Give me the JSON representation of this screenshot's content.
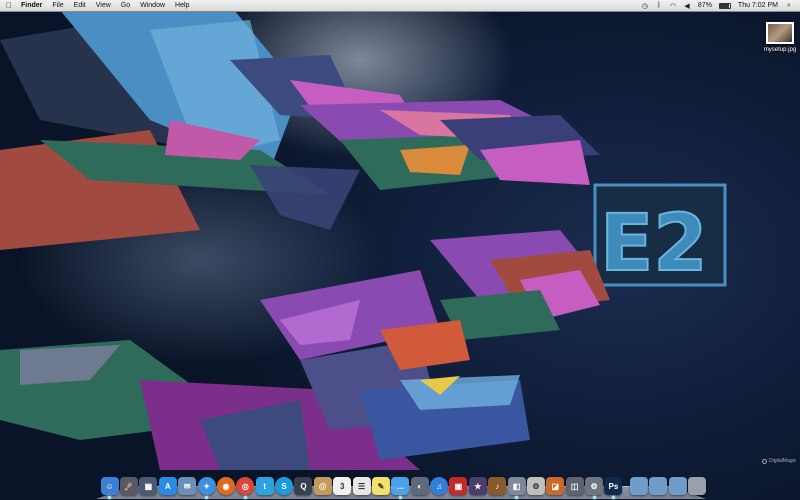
{
  "menubar": {
    "apple_icon": "apple-icon",
    "app_name": "Finder",
    "menus": [
      "File",
      "Edit",
      "View",
      "Go",
      "Window",
      "Help"
    ],
    "battery_percent": "87%",
    "battery_level": 0.87,
    "clock": "Thu 7:02 PM",
    "status_icons": [
      "time-machine-icon",
      "bluetooth-icon",
      "wifi-icon",
      "volume-icon",
      "spotlight-icon"
    ]
  },
  "desktop": {
    "file_name": "mysetup.jpg",
    "watermark": "DigitalMagic",
    "colors": {
      "sky": "#0c1a33",
      "accent_blue": "#4a8fc4",
      "accent_purple": "#8a4bb0",
      "accent_green": "#2f6b5a",
      "accent_red": "#a14a3f"
    }
  },
  "dock": {
    "apps": [
      {
        "name": "finder-icon",
        "color": "#3b7fd6",
        "glyph": "☺",
        "running": true
      },
      {
        "name": "launchpad-icon",
        "color": "#555b66",
        "glyph": "🚀",
        "running": false
      },
      {
        "name": "mission-control-icon",
        "color": "#4b5a72",
        "glyph": "▦",
        "running": false
      },
      {
        "name": "app-store-icon",
        "color": "#2a8ae6",
        "glyph": "A",
        "running": false
      },
      {
        "name": "mail-icon",
        "color": "#6c8fb8",
        "glyph": "✉",
        "running": false
      },
      {
        "name": "safari-icon",
        "color": "#3f8fe0",
        "glyph": "✦",
        "running": true
      },
      {
        "name": "firefox-icon",
        "color": "#e06b1f",
        "glyph": "◉",
        "running": false
      },
      {
        "name": "chrome-icon",
        "color": "#d9463b",
        "glyph": "◎",
        "running": true
      },
      {
        "name": "twitter-icon",
        "color": "#2aa3e0",
        "glyph": "t",
        "running": false
      },
      {
        "name": "skype-icon",
        "color": "#1c9be0",
        "glyph": "S",
        "running": false
      },
      {
        "name": "quicktime-icon",
        "color": "#39404d",
        "glyph": "Q",
        "running": false
      },
      {
        "name": "address-book-icon",
        "color": "#c49a5a",
        "glyph": "@",
        "running": false
      },
      {
        "name": "calendar-icon",
        "color": "#f0f0f0",
        "glyph": "3",
        "running": false
      },
      {
        "name": "reminders-icon",
        "color": "#e8e8e8",
        "glyph": "☰",
        "running": false
      },
      {
        "name": "notes-icon",
        "color": "#f3df6a",
        "glyph": "✎",
        "running": false
      },
      {
        "name": "messages-icon",
        "color": "#4aa3e8",
        "glyph": "…",
        "running": true
      },
      {
        "name": "facetime-icon",
        "color": "#5e6a7a",
        "glyph": "◐",
        "running": false
      },
      {
        "name": "itunes-icon",
        "color": "#2f7fd8",
        "glyph": "♫",
        "running": false
      },
      {
        "name": "photo-booth-icon",
        "color": "#c32a2a",
        "glyph": "▣",
        "running": false
      },
      {
        "name": "imovie-icon",
        "color": "#4a3d6b",
        "glyph": "★",
        "running": false
      },
      {
        "name": "garageband-icon",
        "color": "#8a5a2a",
        "glyph": "♪",
        "running": false
      },
      {
        "name": "preview-icon",
        "color": "#7d8898",
        "glyph": "◧",
        "running": true
      },
      {
        "name": "automator-icon",
        "color": "#bfbfbf",
        "glyph": "⚙",
        "running": false
      },
      {
        "name": "photo-app-icon",
        "color": "#c96a2a",
        "glyph": "◪",
        "running": false
      },
      {
        "name": "image-capture-icon",
        "color": "#5c6470",
        "glyph": "◫",
        "running": false
      },
      {
        "name": "system-preferences-icon",
        "color": "#6e7580",
        "glyph": "⚙",
        "running": true
      },
      {
        "name": "photoshop-icon",
        "color": "#0e2a4d",
        "glyph": "Ps",
        "running": true
      }
    ],
    "stacks": [
      {
        "name": "applications-folder-icon",
        "color": "#6f9cc8"
      },
      {
        "name": "documents-folder-icon",
        "color": "#6f9cc8"
      },
      {
        "name": "downloads-folder-icon",
        "color": "#6f9cc8"
      },
      {
        "name": "trash-icon",
        "color": "#9aa0a8"
      }
    ]
  }
}
